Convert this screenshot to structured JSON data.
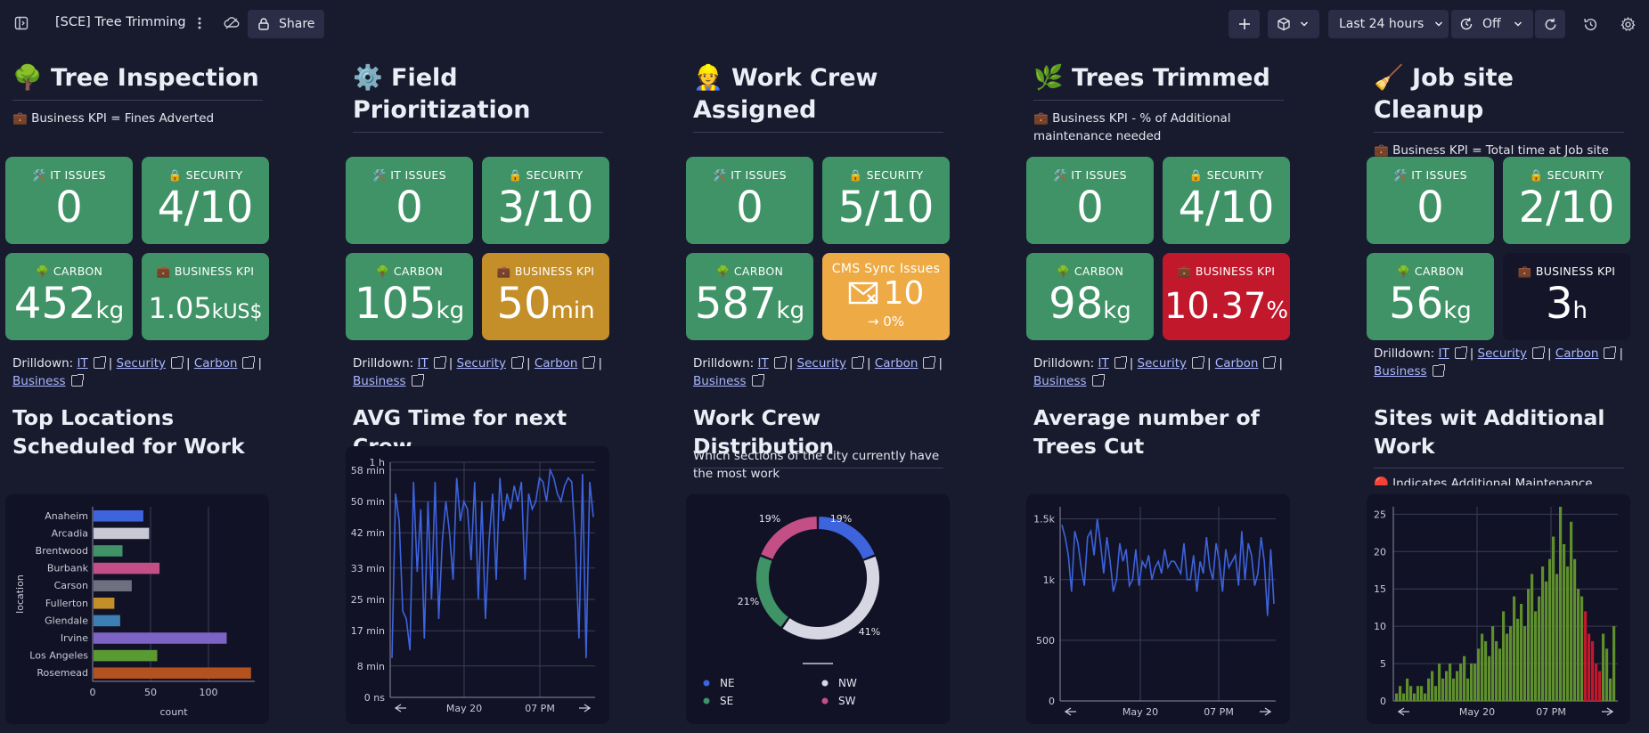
{
  "app": {
    "title": "[SCE] Tree Trimming",
    "share_label": "Share",
    "time_range": "Last 24 hours",
    "refresh_label": "Off"
  },
  "columns": [
    {
      "title": "🌳 Tree Inspection",
      "kpi_note": "💼 Business KPI = Fines Adverted",
      "tiles": [
        {
          "label": "🛠️ IT ISSUES",
          "value": "0",
          "unit": "",
          "color": "#3f9366"
        },
        {
          "label": "🔒 SECURITY",
          "value": "4/10",
          "unit": "",
          "color": "#3f9366"
        },
        {
          "label": "🌳 CARBON",
          "value": "452",
          "unit": "kg",
          "color": "#3f9366"
        },
        {
          "label": "💼 BUSINESS KPI",
          "value": "1.05",
          "unit": "kUS$",
          "color": "#3f9366"
        }
      ],
      "drill": {
        "prefix": "Drilldown:",
        "links": [
          "IT",
          "Security",
          "Carbon",
          "Business"
        ]
      },
      "section_title": "Top Locations Scheduled for Work"
    },
    {
      "title": "⚙️ Field Prioritization",
      "kpi_note": "",
      "tiles": [
        {
          "label": "🛠️ IT ISSUES",
          "value": "0",
          "unit": "",
          "color": "#3f9366"
        },
        {
          "label": "🔒 SECURITY",
          "value": "3/10",
          "unit": "",
          "color": "#3f9366"
        },
        {
          "label": "🌳 CARBON",
          "value": "105",
          "unit": "kg",
          "color": "#3f9366"
        },
        {
          "label": "💼 BUSINESS KPI",
          "value": "50",
          "unit": "min",
          "color": "#c48e29"
        }
      ],
      "drill": {
        "prefix": "Drilldown:",
        "links": [
          "IT",
          "Security",
          "Carbon",
          "Business"
        ]
      },
      "section_title": "AVG Time for next Crew"
    },
    {
      "title": "👷 Work Crew Assigned",
      "kpi_note": "",
      "tiles": [
        {
          "label": "🛠️ IT ISSUES",
          "value": "0",
          "unit": "",
          "color": "#3f9366"
        },
        {
          "label": "🔒 SECURITY",
          "value": "5/10",
          "unit": "",
          "color": "#3f9366"
        },
        {
          "label": "🌳 CARBON",
          "value": "587",
          "unit": "kg",
          "color": "#3f9366"
        },
        {
          "label": "CMS Sync Issues",
          "value": "10",
          "unit": "",
          "sub": "→ 0%",
          "color": "#eeaa45"
        }
      ],
      "drill": {
        "prefix": "Drilldown:",
        "links": [
          "IT",
          "Security",
          "Carbon",
          "Business"
        ]
      },
      "section_title": "Work Crew Distribution",
      "section_note": "Which sections of the city currently have the most work"
    },
    {
      "title": "🌿 Trees Trimmed",
      "kpi_note": "💼 Business KPI - % of Additional maintenance needed",
      "tiles": [
        {
          "label": "🛠️ IT ISSUES",
          "value": "0",
          "unit": "",
          "color": "#3f9366"
        },
        {
          "label": "🔒 SECURITY",
          "value": "4/10",
          "unit": "",
          "color": "#3f9366"
        },
        {
          "label": "🌳 CARBON",
          "value": "98",
          "unit": "kg",
          "color": "#3f9366"
        },
        {
          "label": "💼 BUSINESS KPI",
          "value": "10.37",
          "unit": "%",
          "color": "#c1182c"
        }
      ],
      "drill": {
        "prefix": "Drilldown:",
        "links": [
          "IT",
          "Security",
          "Carbon",
          "Business"
        ]
      },
      "section_title": "Average number of Trees Cut"
    },
    {
      "title": "🧹 Job site Cleanup",
      "kpi_note": "💼 Business KPI = Total time at Job site",
      "tiles": [
        {
          "label": "🛠️ IT ISSUES",
          "value": "0",
          "unit": "",
          "color": "#3f9366"
        },
        {
          "label": "🔒 SECURITY",
          "value": "2/10",
          "unit": "",
          "color": "#3f9366"
        },
        {
          "label": "🌳 CARBON",
          "value": "56",
          "unit": "kg",
          "color": "#3f9366"
        },
        {
          "label": "💼 BUSINESS KPI",
          "value": "3",
          "unit": "h",
          "color": "#141528"
        }
      ],
      "drill": {
        "prefix": "Drilldown:",
        "links": [
          "IT",
          "Security",
          "Carbon",
          "Business"
        ]
      },
      "section_title": "Sites wit Additional Work",
      "section_note": "🔴 Indicates Additional Maintenance needed"
    }
  ],
  "chart_data": [
    {
      "type": "bar",
      "orientation": "horizontal",
      "categories": [
        "Anaheim",
        "Arcadia",
        "Brentwood",
        "Burbank",
        "Carson",
        "Fullerton",
        "Glendale",
        "Irvine",
        "Los Angeles",
        "Rosemead"
      ],
      "values": [
        43,
        48,
        25,
        57,
        33,
        18,
        23,
        115,
        55,
        136
      ],
      "colors": [
        "#3d63dd",
        "#c9c9d6",
        "#3f9366",
        "#c44e86",
        "#6e7080",
        "#c48e29",
        "#3b7fb5",
        "#7c63c4",
        "#5a9a32",
        "#b3521f"
      ],
      "xlabel": "count",
      "ylabel": "location",
      "xticks": [
        "0",
        "50",
        "100"
      ],
      "xlim": [
        0,
        140
      ]
    },
    {
      "type": "line",
      "yticks": [
        "1 h",
        "58 min",
        "50 min",
        "42 min",
        "33 min",
        "25 min",
        "17 min",
        "8 min",
        "0 ns"
      ],
      "xticks": [
        "May 20",
        "07 PM"
      ],
      "ylim": [
        0,
        60
      ],
      "values": [
        10,
        52,
        45,
        22,
        20,
        12,
        55,
        32,
        48,
        15,
        50,
        25,
        55,
        20,
        40,
        50,
        42,
        30,
        56,
        45,
        50,
        48,
        35,
        55,
        25,
        50,
        20,
        40,
        52,
        30,
        56,
        45,
        52,
        48,
        54,
        50,
        55,
        30,
        52,
        48,
        50,
        56,
        55,
        50,
        58,
        56,
        52,
        50,
        54,
        56,
        55,
        40,
        15,
        57,
        10,
        55,
        46
      ],
      "color": "#3d63dd"
    },
    {
      "type": "pie",
      "donut": true,
      "series": [
        {
          "name": "NE",
          "value": 19,
          "label": "19%",
          "color": "#3d63dd"
        },
        {
          "name": "NW",
          "value": 41,
          "label": "41%",
          "color": "#d6d7e2"
        },
        {
          "name": "SE",
          "value": 21,
          "label": "21%",
          "color": "#3f9366"
        },
        {
          "name": "SW",
          "value": 19,
          "label": "19%",
          "color": "#c44e86"
        }
      ]
    },
    {
      "type": "line",
      "yticks": [
        "1.5k",
        "1k",
        "500",
        "0"
      ],
      "xticks": [
        "May 20",
        "07 PM"
      ],
      "ylim": [
        0,
        1600
      ],
      "values": [
        1450,
        1350,
        1200,
        900,
        1400,
        1300,
        1100,
        950,
        1350,
        1400,
        1200,
        1500,
        1300,
        1050,
        1350,
        1150,
        900,
        1000,
        1300,
        1150,
        1250,
        950,
        1000,
        1250,
        950,
        1150,
        1100,
        1200,
        1000,
        1100,
        1150,
        1050,
        1250,
        1100,
        1150,
        1150,
        1100,
        1050,
        1300,
        1000,
        1000,
        1200,
        900,
        1150,
        1050,
        1350,
        1100,
        1000,
        1300,
        1150,
        900,
        1250,
        1100,
        1150,
        1200,
        950,
        1400,
        1000,
        1300,
        1200,
        950,
        1050,
        1350,
        1150,
        700,
        1250,
        800
      ],
      "color": "#3d63dd"
    },
    {
      "type": "bar",
      "orientation": "vertical",
      "yticks": [
        "25",
        "20",
        "15",
        "10",
        "5",
        "0"
      ],
      "xticks": [
        "May 20",
        "07 PM"
      ],
      "ylim": [
        0,
        26
      ],
      "values": [
        1,
        2,
        1,
        3,
        2,
        1,
        2,
        2,
        1,
        3,
        4,
        2,
        5,
        3,
        4,
        5,
        3,
        4,
        5,
        6,
        3,
        5,
        5,
        7,
        9,
        8,
        6,
        10,
        8,
        7,
        12,
        9,
        10,
        14,
        11,
        13,
        10,
        15,
        17,
        12,
        14,
        18,
        16,
        19,
        22,
        17,
        26,
        21,
        18,
        24,
        19,
        15,
        14,
        12,
        9,
        8,
        5,
        4,
        9,
        7,
        3,
        10
      ],
      "red_indices": [
        53,
        54,
        55,
        56,
        57
      ],
      "color": "#5e8f2c",
      "red_color": "#c1182c"
    }
  ]
}
